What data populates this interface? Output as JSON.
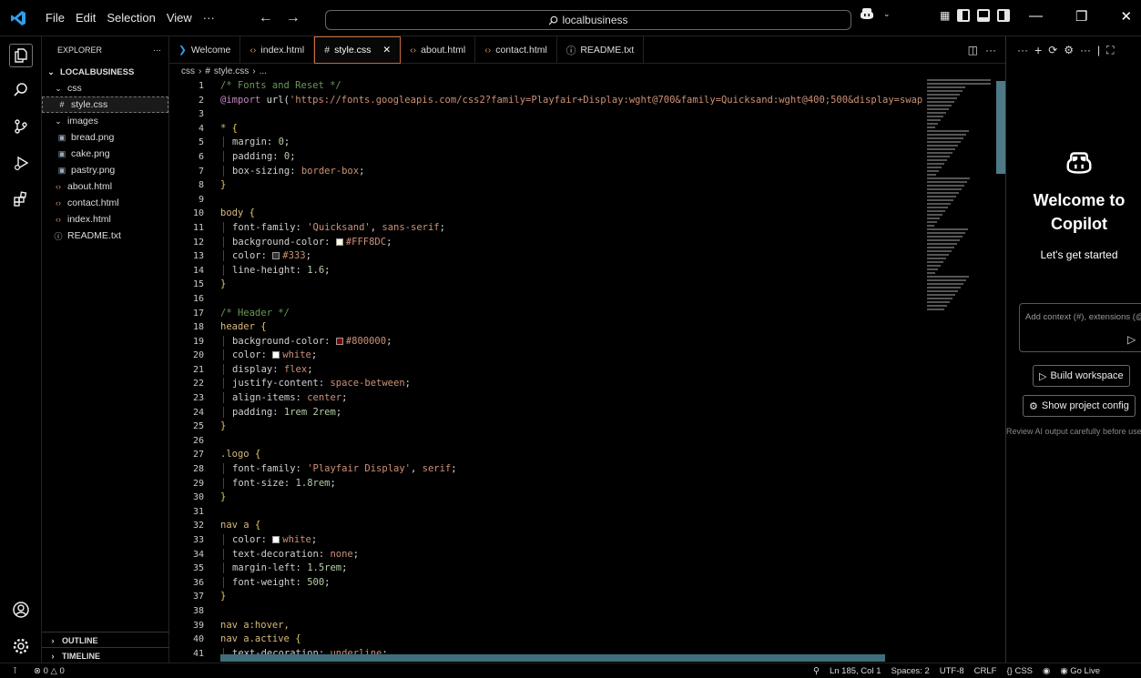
{
  "titlebar": {
    "menu": [
      "File",
      "Edit",
      "Selection",
      "View",
      "···"
    ],
    "search": "localbusiness",
    "copilot_icon": "copilot-icon"
  },
  "explorer": {
    "title": "EXPLORER",
    "more": "···",
    "root": "LOCALBUSINESS",
    "tree": [
      {
        "name": "css",
        "type": "folder",
        "depth": 1
      },
      {
        "name": "style.css",
        "type": "css",
        "depth": 2,
        "selected": true
      },
      {
        "name": "images",
        "type": "folder",
        "depth": 1
      },
      {
        "name": "bread.png",
        "type": "image",
        "depth": 2
      },
      {
        "name": "cake.png",
        "type": "image",
        "depth": 2
      },
      {
        "name": "pastry.png",
        "type": "image",
        "depth": 2
      },
      {
        "name": "about.html",
        "type": "html",
        "depth": 1
      },
      {
        "name": "contact.html",
        "type": "html",
        "depth": 1
      },
      {
        "name": "index.html",
        "type": "html",
        "depth": 1
      },
      {
        "name": "README.txt",
        "type": "info",
        "depth": 1
      }
    ],
    "outline": "OUTLINE",
    "timeline": "TIMELINE"
  },
  "tabs": [
    {
      "label": "Welcome",
      "icon": "vscode-icon"
    },
    {
      "label": "index.html",
      "icon": "html-icon"
    },
    {
      "label": "style.css",
      "icon": "css-icon",
      "active": true
    },
    {
      "label": "about.html",
      "icon": "html-icon"
    },
    {
      "label": "contact.html",
      "icon": "html-icon"
    },
    {
      "label": "README.txt",
      "icon": "info-icon"
    }
  ],
  "breadcrumb": [
    "css",
    "style.css",
    "..."
  ],
  "code": [
    {
      "n": "1",
      "t": [
        [
          "c-com",
          "/* Fonts and Reset */"
        ]
      ]
    },
    {
      "n": "2",
      "t": [
        [
          "c-at",
          "@import"
        ],
        [
          "",
          " url("
        ],
        [
          "c-val",
          "'https://fonts.googleapis.com/css2?family=Playfair+Display:wght@700&family=Quicksand:wght@400;500&display=swap"
        ]
      ]
    },
    {
      "n": "3",
      "t": []
    },
    {
      "n": "4",
      "t": [
        [
          "c-sel",
          "* "
        ],
        [
          "c-punc",
          "{"
        ]
      ]
    },
    {
      "n": "5",
      "i": true,
      "t": [
        [
          "c-prop",
          "margin: "
        ],
        [
          "c-num",
          "0"
        ],
        [
          "",
          ";"
        ]
      ]
    },
    {
      "n": "6",
      "i": true,
      "t": [
        [
          "c-prop",
          "padding: "
        ],
        [
          "c-num",
          "0"
        ],
        [
          "",
          ";"
        ]
      ]
    },
    {
      "n": "7",
      "i": true,
      "t": [
        [
          "c-prop",
          "box-sizing: "
        ],
        [
          "c-val",
          "border-box"
        ],
        [
          "",
          ";"
        ]
      ]
    },
    {
      "n": "8",
      "t": [
        [
          "c-punc",
          "}"
        ]
      ]
    },
    {
      "n": "9",
      "t": []
    },
    {
      "n": "10",
      "t": [
        [
          "c-sel",
          "body "
        ],
        [
          "c-punc",
          "{"
        ]
      ]
    },
    {
      "n": "11",
      "i": true,
      "t": [
        [
          "c-prop",
          "font-family: "
        ],
        [
          "c-val",
          "'Quicksand'"
        ],
        [
          "",
          ", "
        ],
        [
          "c-val",
          "sans-serif"
        ],
        [
          "",
          ";"
        ]
      ]
    },
    {
      "n": "12",
      "i": true,
      "t": [
        [
          "c-prop",
          "background-color: "
        ],
        [
          "swatch",
          "#FFF8DC"
        ],
        [
          "c-val",
          "#FFF8DC"
        ],
        [
          "",
          ";"
        ]
      ]
    },
    {
      "n": "13",
      "i": true,
      "t": [
        [
          "c-prop",
          "color: "
        ],
        [
          "swatch",
          "#333"
        ],
        [
          "c-val",
          "#333"
        ],
        [
          "",
          ";"
        ]
      ]
    },
    {
      "n": "14",
      "i": true,
      "t": [
        [
          "c-prop",
          "line-height: "
        ],
        [
          "c-num",
          "1.6"
        ],
        [
          "",
          ";"
        ]
      ]
    },
    {
      "n": "15",
      "t": [
        [
          "c-punc",
          "}"
        ]
      ]
    },
    {
      "n": "16",
      "t": []
    },
    {
      "n": "17",
      "t": [
        [
          "c-com",
          "/* Header */"
        ]
      ]
    },
    {
      "n": "18",
      "t": [
        [
          "c-sel",
          "header "
        ],
        [
          "c-punc",
          "{"
        ]
      ]
    },
    {
      "n": "19",
      "i": true,
      "t": [
        [
          "c-prop",
          "background-color: "
        ],
        [
          "swatch",
          "#800000"
        ],
        [
          "c-val",
          "#800000"
        ],
        [
          "",
          ";"
        ]
      ]
    },
    {
      "n": "20",
      "i": true,
      "t": [
        [
          "c-prop",
          "color: "
        ],
        [
          "swatch",
          "white"
        ],
        [
          "c-val",
          "white"
        ],
        [
          "",
          ";"
        ]
      ]
    },
    {
      "n": "21",
      "i": true,
      "t": [
        [
          "c-prop",
          "display: "
        ],
        [
          "c-val",
          "flex"
        ],
        [
          "",
          ";"
        ]
      ]
    },
    {
      "n": "22",
      "i": true,
      "t": [
        [
          "c-prop",
          "justify-content: "
        ],
        [
          "c-val",
          "space-between"
        ],
        [
          "",
          ";"
        ]
      ]
    },
    {
      "n": "23",
      "i": true,
      "t": [
        [
          "c-prop",
          "align-items: "
        ],
        [
          "c-val",
          "center"
        ],
        [
          "",
          ";"
        ]
      ]
    },
    {
      "n": "24",
      "i": true,
      "t": [
        [
          "c-prop",
          "padding: "
        ],
        [
          "c-num",
          "1rem 2rem"
        ],
        [
          "",
          ";"
        ]
      ]
    },
    {
      "n": "25",
      "t": [
        [
          "c-punc",
          "}"
        ]
      ]
    },
    {
      "n": "26",
      "t": []
    },
    {
      "n": "27",
      "t": [
        [
          "c-sel",
          ".logo "
        ],
        [
          "c-punc",
          "{"
        ]
      ]
    },
    {
      "n": "28",
      "i": true,
      "t": [
        [
          "c-prop",
          "font-family: "
        ],
        [
          "c-val",
          "'Playfair Display'"
        ],
        [
          "",
          ", "
        ],
        [
          "c-val",
          "serif"
        ],
        [
          "",
          ";"
        ]
      ]
    },
    {
      "n": "29",
      "i": true,
      "t": [
        [
          "c-prop",
          "font-size: "
        ],
        [
          "c-num",
          "1.8rem"
        ],
        [
          "",
          ";"
        ]
      ]
    },
    {
      "n": "30",
      "t": [
        [
          "c-punc",
          "}"
        ]
      ]
    },
    {
      "n": "31",
      "t": []
    },
    {
      "n": "32",
      "t": [
        [
          "c-sel",
          "nav a "
        ],
        [
          "c-punc",
          "{"
        ]
      ]
    },
    {
      "n": "33",
      "i": true,
      "t": [
        [
          "c-prop",
          "color: "
        ],
        [
          "swatch",
          "white"
        ],
        [
          "c-val",
          "white"
        ],
        [
          "",
          ";"
        ]
      ]
    },
    {
      "n": "34",
      "i": true,
      "t": [
        [
          "c-prop",
          "text-decoration: "
        ],
        [
          "c-val",
          "none"
        ],
        [
          "",
          ";"
        ]
      ]
    },
    {
      "n": "35",
      "i": true,
      "t": [
        [
          "c-prop",
          "margin-left: "
        ],
        [
          "c-num",
          "1.5rem"
        ],
        [
          "",
          ";"
        ]
      ]
    },
    {
      "n": "36",
      "i": true,
      "t": [
        [
          "c-prop",
          "font-weight: "
        ],
        [
          "c-num",
          "500"
        ],
        [
          "",
          ";"
        ]
      ]
    },
    {
      "n": "37",
      "t": [
        [
          "c-punc",
          "}"
        ]
      ]
    },
    {
      "n": "38",
      "t": []
    },
    {
      "n": "39",
      "t": [
        [
          "c-sel",
          "nav a:hover,"
        ]
      ]
    },
    {
      "n": "40",
      "t": [
        [
          "c-sel",
          "nav a.active "
        ],
        [
          "c-punc",
          "{"
        ]
      ]
    },
    {
      "n": "41",
      "i": true,
      "t": [
        [
          "c-prop",
          "text-decoration: "
        ],
        [
          "c-val",
          "underline"
        ],
        [
          "",
          ";"
        ]
      ]
    }
  ],
  "copilot": {
    "title_line1": "Welcome to",
    "title_line2": "Copilot",
    "subtitle": "Let's get started",
    "input_placeholder": "Add context (#), extensions (@), commands (/)",
    "build_workspace": "Build workspace",
    "show_project_config": "Show project config",
    "note": "Review AI output carefully before use."
  },
  "status": {
    "problems": "0",
    "warnings": "0",
    "position": "Ln 185, Col 1",
    "spaces": "Spaces: 2",
    "encoding": "UTF-8",
    "eol": "CRLF",
    "language": "CSS",
    "golive": "Go Live"
  }
}
